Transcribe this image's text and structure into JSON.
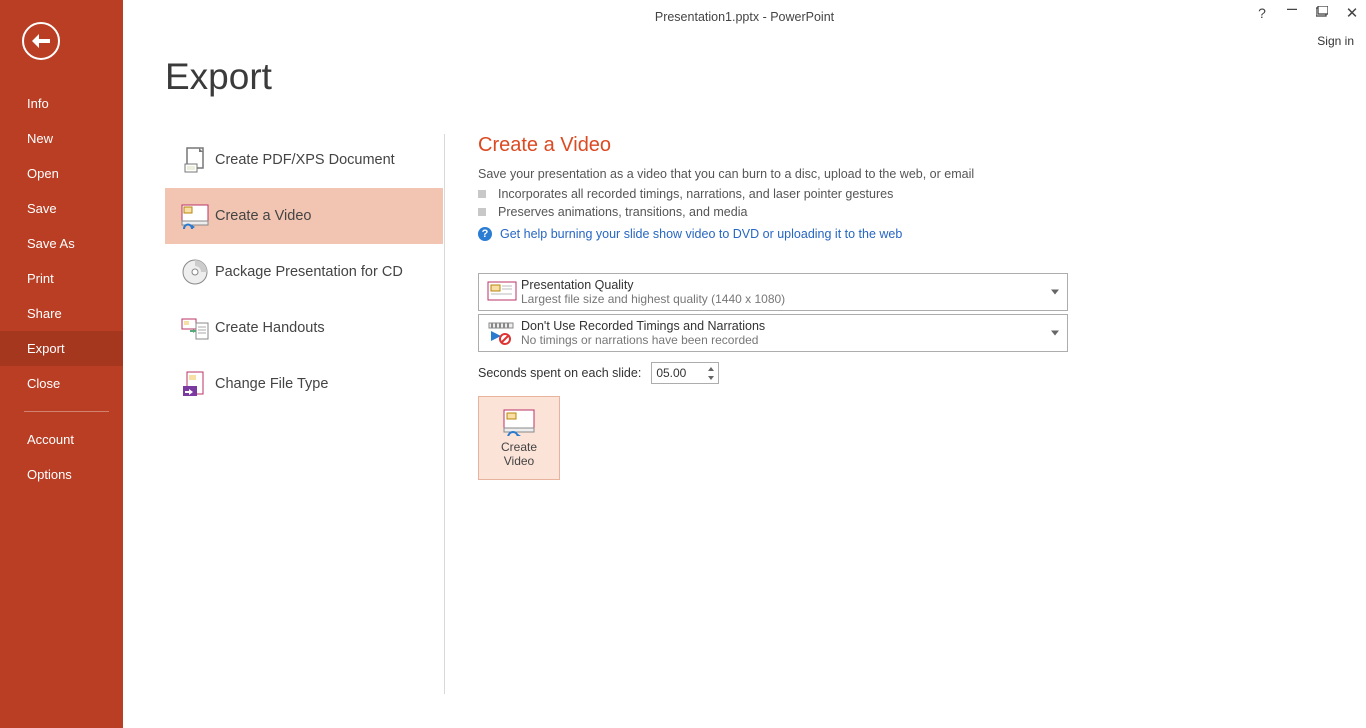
{
  "titlebar": {
    "title": "Presentation1.pptx - PowerPoint",
    "signin": "Sign in"
  },
  "sidebar": {
    "items": [
      "Info",
      "New",
      "Open",
      "Save",
      "Save As",
      "Print",
      "Share",
      "Export",
      "Close"
    ],
    "active_index": 7,
    "footer": [
      "Account",
      "Options"
    ]
  },
  "page_title": "Export",
  "export_options": [
    {
      "label": "Create PDF/XPS Document"
    },
    {
      "label": "Create a Video"
    },
    {
      "label": "Package Presentation for CD"
    },
    {
      "label": "Create Handouts"
    },
    {
      "label": "Change File Type"
    }
  ],
  "export_active_index": 1,
  "detail": {
    "title": "Create a Video",
    "desc": "Save your presentation as a video that you can burn to a disc, upload to the web, or email",
    "bullets": [
      "Incorporates all recorded timings, narrations, and laser pointer gestures",
      "Preserves animations, transitions, and media"
    ],
    "help_link": "Get help burning your slide show video to DVD or uploading it to the web",
    "quality": {
      "title": "Presentation Quality",
      "sub": "Largest file size and highest quality (1440 x 1080)"
    },
    "timings": {
      "title": "Don't Use Recorded Timings and Narrations",
      "sub": "No timings or narrations have been recorded"
    },
    "seconds_label": "Seconds spent on each slide:",
    "seconds_value": "05.00",
    "button_line1": "Create",
    "button_line2": "Video"
  }
}
